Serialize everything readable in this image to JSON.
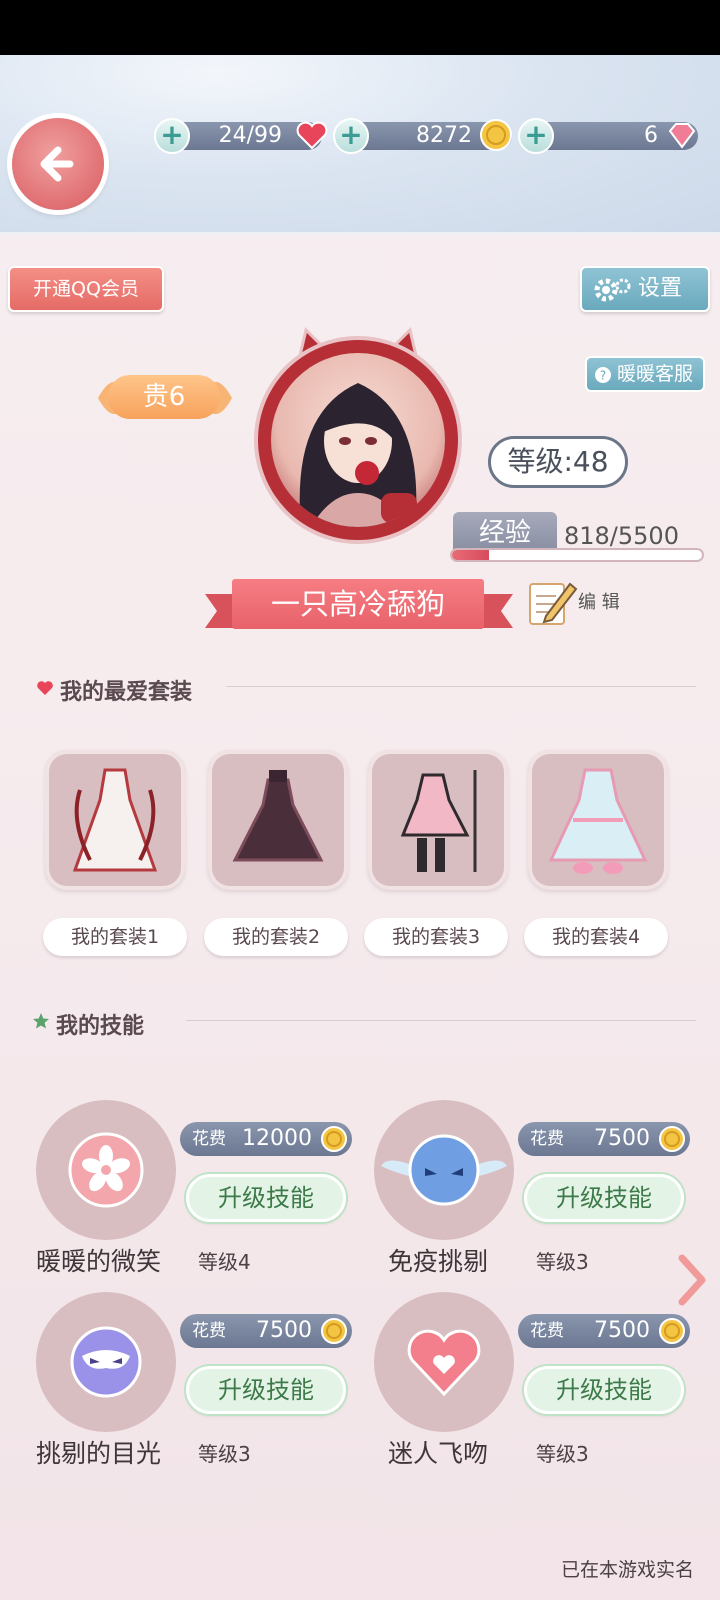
{
  "resources": {
    "stamina": "24/99",
    "gold": "8272",
    "diamond": "6"
  },
  "buttons": {
    "qq_member": "开通QQ会员",
    "settings": "设置",
    "customer_service": "暖暖客服",
    "edit": "编 辑"
  },
  "profile": {
    "vip": "贵6",
    "level": "等级:48",
    "exp_label": "经验",
    "exp_value": "818/5500",
    "exp_fraction": 0.149,
    "name": "一只高冷舔狗"
  },
  "outfits": {
    "title": "我的最爱套装",
    "items": [
      {
        "label": "我的套装1"
      },
      {
        "label": "我的套装2"
      },
      {
        "label": "我的套装3"
      },
      {
        "label": "我的套装4"
      }
    ]
  },
  "skills": {
    "title": "我的技能",
    "cost_label": "花费",
    "upgrade_label": "升级技能",
    "items": [
      {
        "name": "暖暖的微笑",
        "level": "等级4",
        "cost": "12000"
      },
      {
        "name": "免疫挑剔",
        "level": "等级3",
        "cost": "7500"
      },
      {
        "name": "挑剔的目光",
        "level": "等级3",
        "cost": "7500"
      },
      {
        "name": "迷人飞吻",
        "level": "等级3",
        "cost": "7500"
      }
    ]
  },
  "footer": {
    "realname": "已在本游戏实名"
  },
  "colors": {
    "accent_red": "#e8626b",
    "accent_blue": "#6aa9bd",
    "green_button": "#e3f4e6"
  }
}
